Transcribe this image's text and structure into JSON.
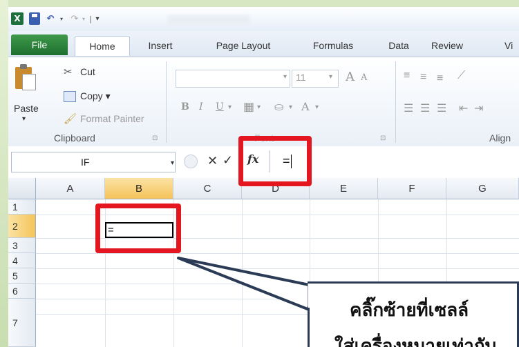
{
  "quick_access": {
    "app_icon": "X",
    "save_icon": "save-icon",
    "undo_glyph": "↶",
    "redo_glyph": "↷",
    "dropdown_glyph": "▾",
    "separator_glyph": "|",
    "customize_glyph": "▾"
  },
  "tabs": [
    "File",
    "Home",
    "Insert",
    "Page Layout",
    "Formulas",
    "Data",
    "Review",
    "Vi"
  ],
  "ribbon": {
    "clipboard": {
      "paste": "Paste",
      "cut": "Cut",
      "copy": "Copy ▾",
      "format_painter": "Format Painter",
      "group_label": "Clipboard",
      "launcher": "⊡"
    },
    "font": {
      "size": "11",
      "size_drop": "▾",
      "name_drop": "▾",
      "grow": "A",
      "shrink": "A",
      "bold": "B",
      "italic": "I",
      "underline": "U",
      "underline_drop": "▾",
      "borders": "▦",
      "borders_drop": "▾",
      "fill_drop": "▾",
      "font_color": "A",
      "font_color_drop": "▾",
      "group_label": "Font",
      "launcher": "⊡"
    },
    "alignment": {
      "group_label": "Align"
    }
  },
  "formula_bar": {
    "name_box": "IF",
    "name_drop": "▾",
    "cancel": "✕",
    "enter": "✓",
    "fx": "fx",
    "formula": "="
  },
  "grid": {
    "columns": [
      "A",
      "B",
      "C",
      "D",
      "E",
      "F",
      "G"
    ],
    "rows": [
      "1",
      "2",
      "3",
      "4",
      "5",
      "6",
      "7"
    ],
    "selected_column": "B",
    "selected_row": "2",
    "active_cell_value": "="
  },
  "annotation": {
    "callout_line1": "คลิ๊กซ้ายที่เซลล์",
    "callout_line2": "ใส่เครื่องหมายเท่ากับ"
  },
  "colors": {
    "highlight": "#e4161f",
    "file_tab": "#2a7d39",
    "callout_border": "#2b3a55"
  }
}
